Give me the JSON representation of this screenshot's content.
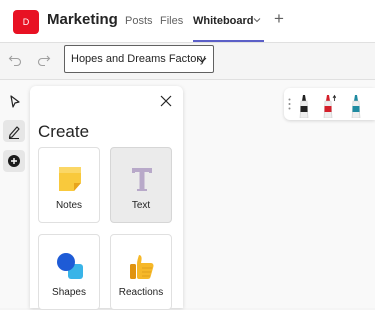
{
  "header": {
    "team_avatar": "D",
    "team_name": "Marketing",
    "tabs": [
      "Posts",
      "Files",
      "Whiteboard"
    ],
    "add_tab": "+"
  },
  "toolbar": {
    "board_name": "Hopes and Dreams Factory"
  },
  "panel": {
    "title": "Create",
    "items": [
      {
        "label": "Notes",
        "icon": "sticky-note-icon"
      },
      {
        "label": "Text",
        "icon": "text-icon"
      },
      {
        "label": "Shapes",
        "icon": "shapes-icon"
      },
      {
        "label": "Reactions",
        "icon": "thumbs-up-icon"
      }
    ]
  },
  "pens": [
    {
      "color": "#222222",
      "icon": "black-pen-icon"
    },
    {
      "color": "#d41f2a",
      "icon": "red-pen-icon"
    },
    {
      "color": "#1f8aa0",
      "icon": "teal-pen-icon"
    }
  ],
  "colors": {
    "accent": "#5b5fc7",
    "team_avatar": "#e81123"
  }
}
